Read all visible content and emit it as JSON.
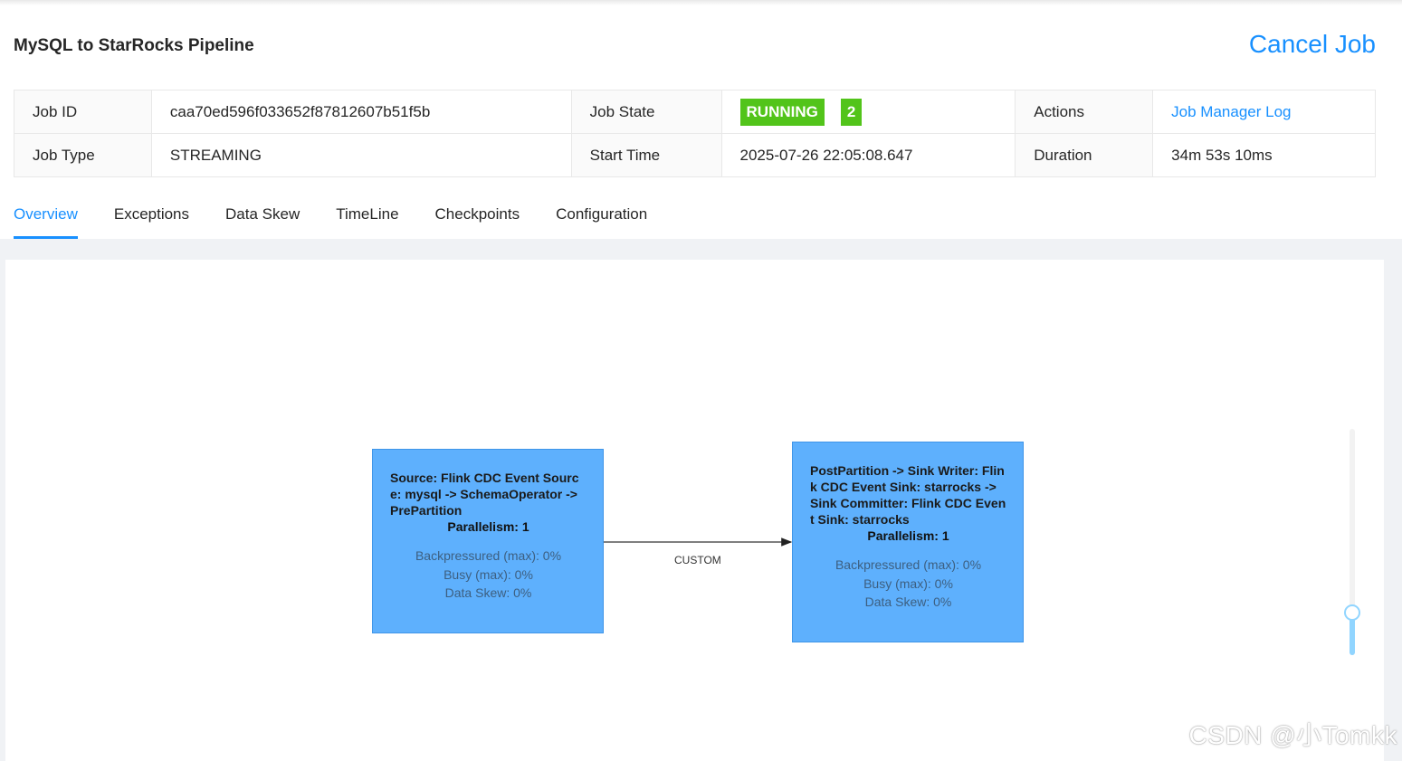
{
  "header": {
    "title": "MySQL to StarRocks Pipeline",
    "cancel_label": "Cancel Job"
  },
  "info": {
    "job_id_label": "Job ID",
    "job_id": "caa70ed596f033652f87812607b51f5b",
    "job_state_label": "Job State",
    "job_state": "RUNNING",
    "job_state_count": "2",
    "actions_label": "Actions",
    "actions_link": "Job Manager Log",
    "job_type_label": "Job Type",
    "job_type": "STREAMING",
    "start_time_label": "Start Time",
    "start_time": "2025-07-26 22:05:08.647",
    "duration_label": "Duration",
    "duration": "34m 53s 10ms"
  },
  "tabs": [
    {
      "label": "Overview",
      "active": true
    },
    {
      "label": "Exceptions"
    },
    {
      "label": "Data Skew"
    },
    {
      "label": "TimeLine"
    },
    {
      "label": "Checkpoints"
    },
    {
      "label": "Configuration"
    }
  ],
  "graph": {
    "nodes": [
      {
        "name": "Source: Flink CDC Event Source: mysql -> SchemaOperator -> PrePartition",
        "parallelism": "Parallelism: 1",
        "backpressured": "Backpressured (max): 0%",
        "busy": "Busy (max): 0%",
        "skew": "Data Skew: 0%"
      },
      {
        "name": "PostPartition -> Sink Writer: Flink CDC Event Sink: starrocks -> Sink Committer: Flink CDC Event Sink: starrocks",
        "parallelism": "Parallelism: 1",
        "backpressured": "Backpressured (max): 0%",
        "busy": "Busy (max): 0%",
        "skew": "Data Skew: 0%"
      }
    ],
    "edge_label": "CUSTOM",
    "zoom_level": 0.2
  },
  "colors": {
    "accent": "#1890ff",
    "running": "#52c41a",
    "node_fill": "#5eb0fd"
  },
  "watermark": "CSDN @小Tomkk"
}
